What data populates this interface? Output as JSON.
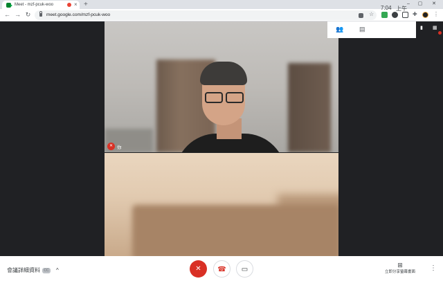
{
  "browser": {
    "tab_title": "Meet - mzf-pcuk-woo",
    "tab_close": "×",
    "new_tab": "+",
    "url": "meet.google.com/mzf-pcuk-woo",
    "nav": {
      "back": "←",
      "forward": "→",
      "reload": "↻"
    },
    "window": {
      "minimize": "–",
      "maximize": "▢",
      "close": "✕"
    },
    "ext_colors": [
      "#5f6368",
      "#34a853",
      "#3c4043",
      "#3c4043",
      "#5f6368",
      "#202124"
    ]
  },
  "meet": {
    "self_label": "你",
    "self_mic_icon": "mic-off-icon",
    "time": "7:04",
    "ampm": "上午",
    "people_icon": "people-icon",
    "chat_icon": "chat-icon"
  },
  "bottom": {
    "details_label": "會議詳細資料",
    "cc_label": "CC",
    "chevron": "^",
    "mic_icon": "🎙",
    "hangup_icon": "☎",
    "camera_icon": "▭",
    "present_icon": "⊞",
    "present_label": "立即分享螢幕畫面",
    "more_icon": "⋮"
  },
  "colors": {
    "accent_red": "#d93025",
    "stage_bg": "#202124"
  }
}
